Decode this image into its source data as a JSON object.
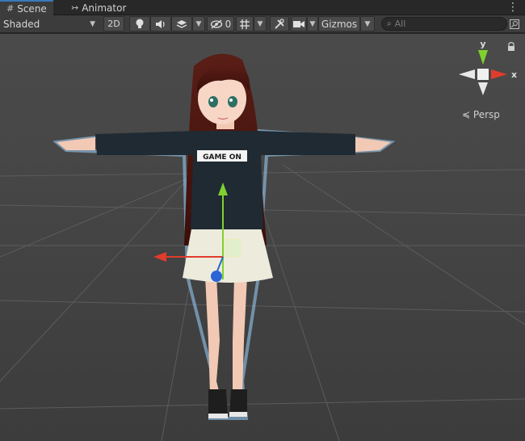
{
  "tabs": [
    {
      "label": "Scene",
      "icon": "grid-icon",
      "active": true
    },
    {
      "label": "Animator",
      "icon": "animator-icon",
      "active": false
    }
  ],
  "toolbar": {
    "draw_mode": "Shaded",
    "mode_2d": "2D",
    "hidden_count": "0",
    "gizmos": "Gizmos",
    "search_placeholder": "All"
  },
  "gizmo": {
    "y_label": "y",
    "x_label": "x",
    "projection": "Persp"
  },
  "character": {
    "hoodie_text": "GAME ON"
  },
  "colors": {
    "x_axis": "#e03c2c",
    "y_axis": "#7fd12e",
    "z_axis": "#2d64d8",
    "selection_outline": "#9ad3ff"
  }
}
